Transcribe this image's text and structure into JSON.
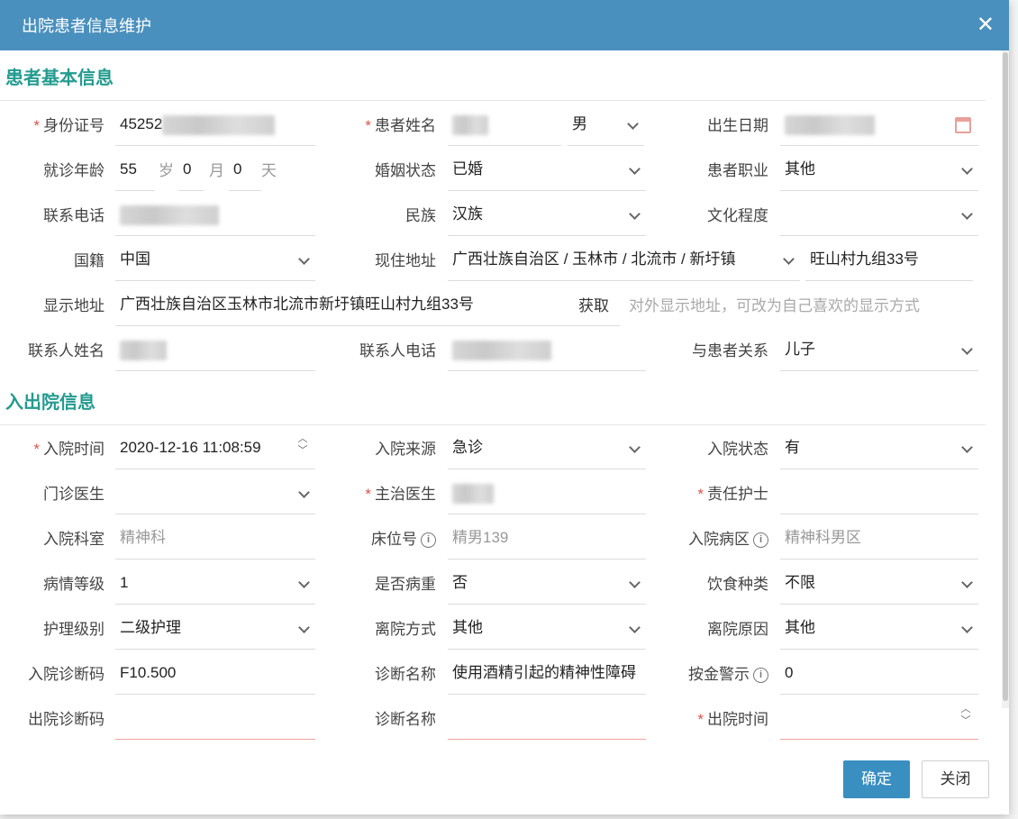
{
  "dialog": {
    "title": "出院患者信息维护"
  },
  "sections": {
    "basic": "患者基本信息",
    "admission": "入出院信息"
  },
  "basic": {
    "id_card": {
      "label": "身份证号",
      "value": "45252"
    },
    "name": {
      "label": "患者姓名",
      "gender": "男"
    },
    "birth": {
      "label": "出生日期"
    },
    "age": {
      "label": "就诊年龄",
      "years": "55",
      "years_unit": "岁",
      "months": "0",
      "months_unit": "月",
      "days": "0",
      "days_unit": "天"
    },
    "marital": {
      "label": "婚姻状态",
      "value": "已婚"
    },
    "occupation": {
      "label": "患者职业",
      "value": "其他"
    },
    "phone": {
      "label": "联系电话"
    },
    "ethnicity": {
      "label": "民族",
      "value": "汉族"
    },
    "education": {
      "label": "文化程度",
      "value": ""
    },
    "nationality": {
      "label": "国籍",
      "value": "中国"
    },
    "address": {
      "label": "现住地址",
      "region": "广西壮族自治区 / 玉林市 / 北流市 / 新圩镇",
      "detail": "旺山村九组33号"
    },
    "display_address": {
      "label": "显示地址",
      "value": "广西壮族自治区玉林市北流市新圩镇旺山村九组33号",
      "fetch": "获取",
      "hint": "对外显示地址，可改为自己喜欢的显示方式"
    },
    "contact_name": {
      "label": "联系人姓名"
    },
    "contact_phone": {
      "label": "联系人电话"
    },
    "relation": {
      "label": "与患者关系",
      "value": "儿子"
    }
  },
  "admission": {
    "admit_time": {
      "label": "入院时间",
      "value": "2020-12-16 11:08:59"
    },
    "source": {
      "label": "入院来源",
      "value": "急诊"
    },
    "admit_status": {
      "label": "入院状态",
      "value": "有"
    },
    "outpatient_doctor": {
      "label": "门诊医生",
      "value": ""
    },
    "attending_doctor": {
      "label": "主治医生"
    },
    "nurse": {
      "label": "责任护士",
      "value": ""
    },
    "department": {
      "label": "入院科室",
      "value": "精神科"
    },
    "bed": {
      "label": "床位号",
      "value": "精男139"
    },
    "ward": {
      "label": "入院病区",
      "value": "精神科男区"
    },
    "severity": {
      "label": "病情等级",
      "value": "1"
    },
    "critical": {
      "label": "是否病重",
      "value": "否"
    },
    "diet": {
      "label": "饮食种类",
      "value": "不限"
    },
    "nursing_level": {
      "label": "护理级别",
      "value": "二级护理"
    },
    "discharge_method": {
      "label": "离院方式",
      "value": "其他"
    },
    "discharge_reason": {
      "label": "离院原因",
      "value": "其他"
    },
    "admit_diag_code": {
      "label": "入院诊断码",
      "value": "F10.500"
    },
    "admit_diag_name": {
      "label": "诊断名称",
      "value": "使用酒精引起的精神性障碍"
    },
    "money_alert": {
      "label": "按金警示",
      "value": "0"
    },
    "discharge_diag_code": {
      "label": "出院诊断码",
      "value": ""
    },
    "discharge_diag_name": {
      "label": "诊断名称",
      "value": ""
    },
    "discharge_time": {
      "label": "出院时间",
      "value": ""
    }
  },
  "footer": {
    "confirm": "确定",
    "close": "关闭"
  }
}
